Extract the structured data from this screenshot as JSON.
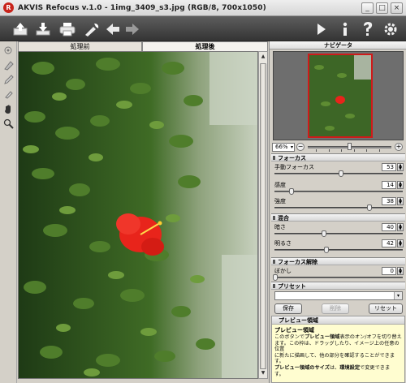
{
  "window": {
    "title": "AKVIS Refocus v.1.0 - 1img_3409_s3.jpg (RGB/8, 700x1050)",
    "minimize_label": "_",
    "maximize_label": "□",
    "close_label": "×"
  },
  "toolbar": {
    "left_icons": [
      "open-icon",
      "save-icon",
      "print-icon",
      "settings-link-icon",
      "back-arrow-icon",
      "forward-arrow-icon"
    ],
    "right_icons": [
      "run-icon",
      "info-icon",
      "help-icon",
      "preferences-gear-icon"
    ]
  },
  "tools": [
    "focus-brush-icon",
    "eraser-icon",
    "pencil-icon",
    "marker-icon",
    "hand-icon",
    "zoom-icon"
  ],
  "tabs": {
    "before": "処理前",
    "after": "処理後"
  },
  "navigator": {
    "title": "ナビゲータ",
    "zoom_value": "66%",
    "zoom_out_label": "−",
    "zoom_in_label": "+"
  },
  "sections": {
    "focus": {
      "title": "フォーカス",
      "params": [
        {
          "label": "手動フォーカス",
          "value": "53"
        },
        {
          "label": "感度",
          "value": "14"
        },
        {
          "label": "強度",
          "value": "38"
        }
      ]
    },
    "blend": {
      "title": "混合",
      "params": [
        {
          "label": "暗さ",
          "value": "40"
        },
        {
          "label": "明るさ",
          "value": "42"
        }
      ]
    },
    "unfocus": {
      "title": "フォーカス解除",
      "params": [
        {
          "label": "ぼかし",
          "value": "0"
        }
      ]
    },
    "preset": {
      "title": "プリセット",
      "save": "保存",
      "delete": "削除",
      "reset": "リセット"
    }
  },
  "help": {
    "section_title": "プレビュー領域",
    "title": "プレビュー領域",
    "line1_a": "このボタンで",
    "line1_b": "プレビュー領域",
    "line1_c": "表示のオン/オフを切り替え",
    "line2": "ます。この枠は、ドラッグしたり、イメージ上の任意の位置",
    "line3": "に新たに描画して、他の部分を確認することができます。",
    "line4_a": "プレビュー領域のサイズ",
    "line4_b": "は、",
    "line4_c": "環境設定",
    "line4_d": "で変更できま",
    "line5": "す。"
  },
  "colors": {
    "toolbar_bg": "#3c3c3c",
    "help_bg": "#fffdd0",
    "preview_frame": "#cf1a1a",
    "flower": "#e8241b"
  }
}
